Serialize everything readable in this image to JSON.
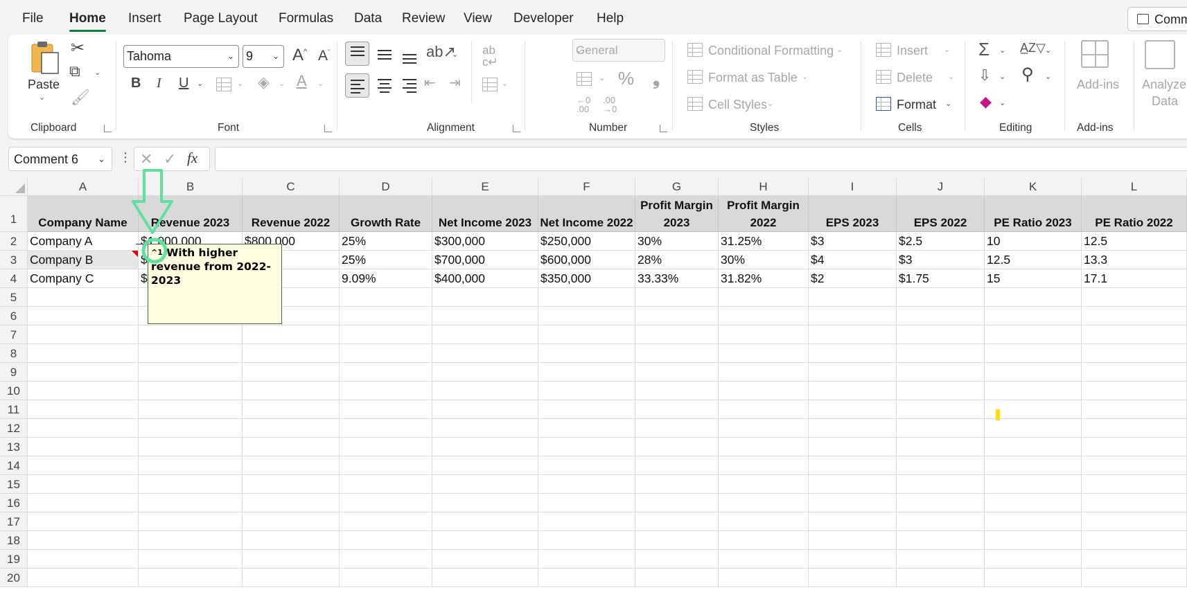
{
  "menu": {
    "tabs": [
      "File",
      "Home",
      "Insert",
      "Page Layout",
      "Formulas",
      "Data",
      "Review",
      "View",
      "Developer",
      "Help"
    ],
    "active_tab": "Home",
    "comments_label": "Comm"
  },
  "ribbon": {
    "clipboard": {
      "label": "Clipboard",
      "paste": "Paste"
    },
    "font": {
      "label": "Font",
      "font_name": "Tahoma",
      "font_size": "9"
    },
    "alignment": {
      "label": "Alignment"
    },
    "number": {
      "label": "Number",
      "format": "General"
    },
    "styles": {
      "label": "Styles",
      "conditional": "Conditional Formatting",
      "format_table": "Format as Table",
      "cell_styles": "Cell Styles"
    },
    "cells": {
      "label": "Cells",
      "insert": "Insert",
      "delete": "Delete",
      "format": "Format"
    },
    "editing": {
      "label": "Editing"
    },
    "addins": {
      "label": "Add-ins",
      "addins_btn": "Add-ins",
      "analyze_line1": "Analyze",
      "analyze_line2": "Data"
    }
  },
  "formula_bar": {
    "name_box": "Comment 6",
    "fx": "fx",
    "content": ""
  },
  "sheet": {
    "columns": [
      "A",
      "B",
      "C",
      "D",
      "E",
      "F",
      "G",
      "H",
      "I",
      "J",
      "K",
      "L"
    ],
    "rows": [
      "1",
      "2",
      "3",
      "4",
      "5",
      "6",
      "7",
      "8",
      "9",
      "10",
      "11",
      "12",
      "13",
      "14",
      "15",
      "16",
      "17",
      "18",
      "19",
      "20"
    ],
    "headers": [
      "Company Name",
      "Revenue 2023",
      "Revenue 2022",
      "Growth Rate",
      "Net Income 2023",
      "Net Income 2022",
      "Profit Margin 2023",
      "Profit Margin 2022",
      "EPS 2023",
      "EPS 2022",
      "PE Ratio 2023",
      "PE Ratio 2022"
    ],
    "data": [
      [
        "Company A",
        "$1,000,000",
        "$800,000",
        "25%",
        "$300,000",
        "$250,000",
        "30%",
        "31.25%",
        "$3",
        "$2.5",
        "10",
        "12.5"
      ],
      [
        "Company B",
        "$2,500,000",
        "$2,000,000",
        "25%",
        "$700,000",
        "$600,000",
        "28%",
        "30%",
        "$4",
        "$3",
        "12.5",
        "13.3"
      ],
      [
        "Company C",
        "$1,200,000",
        "$1,100,000",
        "9.09%",
        "$400,000",
        "$350,000",
        "33.33%",
        "31.82%",
        "$2",
        "$1.75",
        "15",
        "17.1"
      ]
    ],
    "visible_b": [
      "$1,000,000",
      "$",
      "$"
    ],
    "visible_c": [
      "$800,000",
      "0,000",
      "0,000"
    ]
  },
  "comment": {
    "text": "With higher revenue from 2022-2023",
    "marker": "^1"
  },
  "colors": {
    "accent": "#107c41",
    "header_fill": "#d9d9d9",
    "comment_bg": "#ffffe1",
    "annotation": "#5ee0a0"
  }
}
